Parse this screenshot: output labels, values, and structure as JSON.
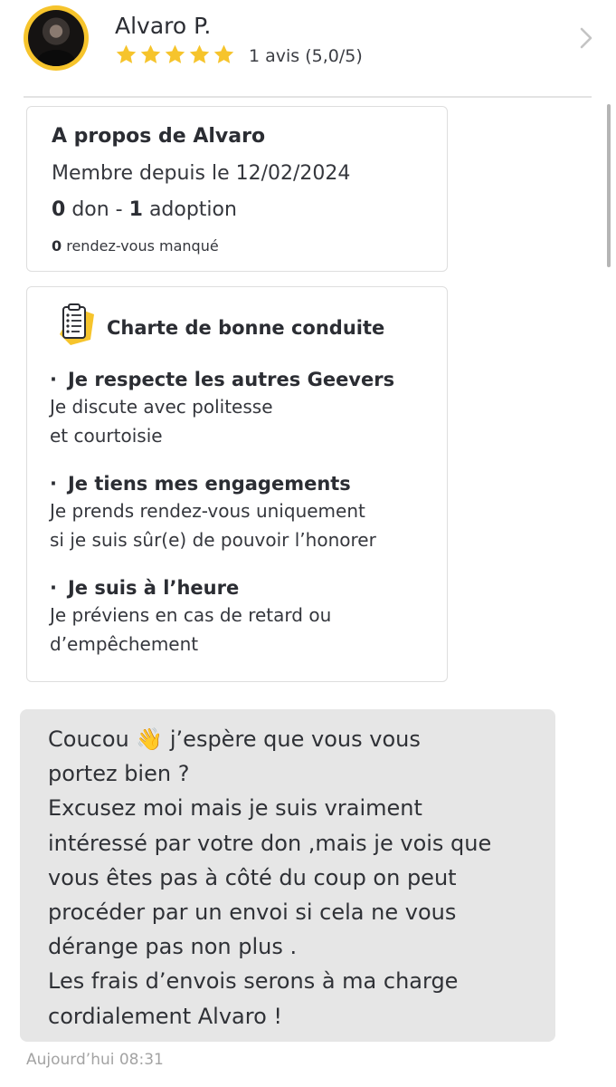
{
  "profile": {
    "name": "Alvaro P.",
    "rating_text": "1 avis (5,0/5)",
    "stars": 5,
    "star_color": "#f6c42c"
  },
  "about": {
    "title": "A propos de Alvaro",
    "member_since": "Membre depuis le 12/02/2024",
    "gifts_count": "0",
    "gifts_label": "don -",
    "adoptions_count": "1",
    "adoptions_label": "adoption",
    "missed_count": "0",
    "missed_label": "rendez-vous manqué"
  },
  "charter": {
    "title": "Charte de bonne conduite",
    "icon": "checklist-icon",
    "rules": [
      {
        "title": "Je respecte les autres Geevers",
        "description": "Je discute avec politesse\net courtoisie"
      },
      {
        "title": "Je tiens mes engagements",
        "description": "Je prends rendez-vous uniquement\nsi je suis sûr(e) de pouvoir l’honorer"
      },
      {
        "title": "Je suis à l’heure",
        "description": "Je préviens en cas de retard ou\nd’empêchement"
      }
    ]
  },
  "message": {
    "text": "Coucou 👋 j’espère que vous vous\nportez bien ?\nExcusez moi mais je suis vraiment\nintéressé par votre don ,mais je vois que\nvous êtes pas à côté du coup on peut\nprocéder par un envoi si cela ne vous\ndérange pas non plus .\nLes frais d’envois serons à ma charge\ncordialement Alvaro !",
    "timestamp": "Aujourd’hui 08:31"
  },
  "colors": {
    "accent": "#f6c42c",
    "bubble": "#e6e6e6",
    "card_border": "#dedede"
  }
}
